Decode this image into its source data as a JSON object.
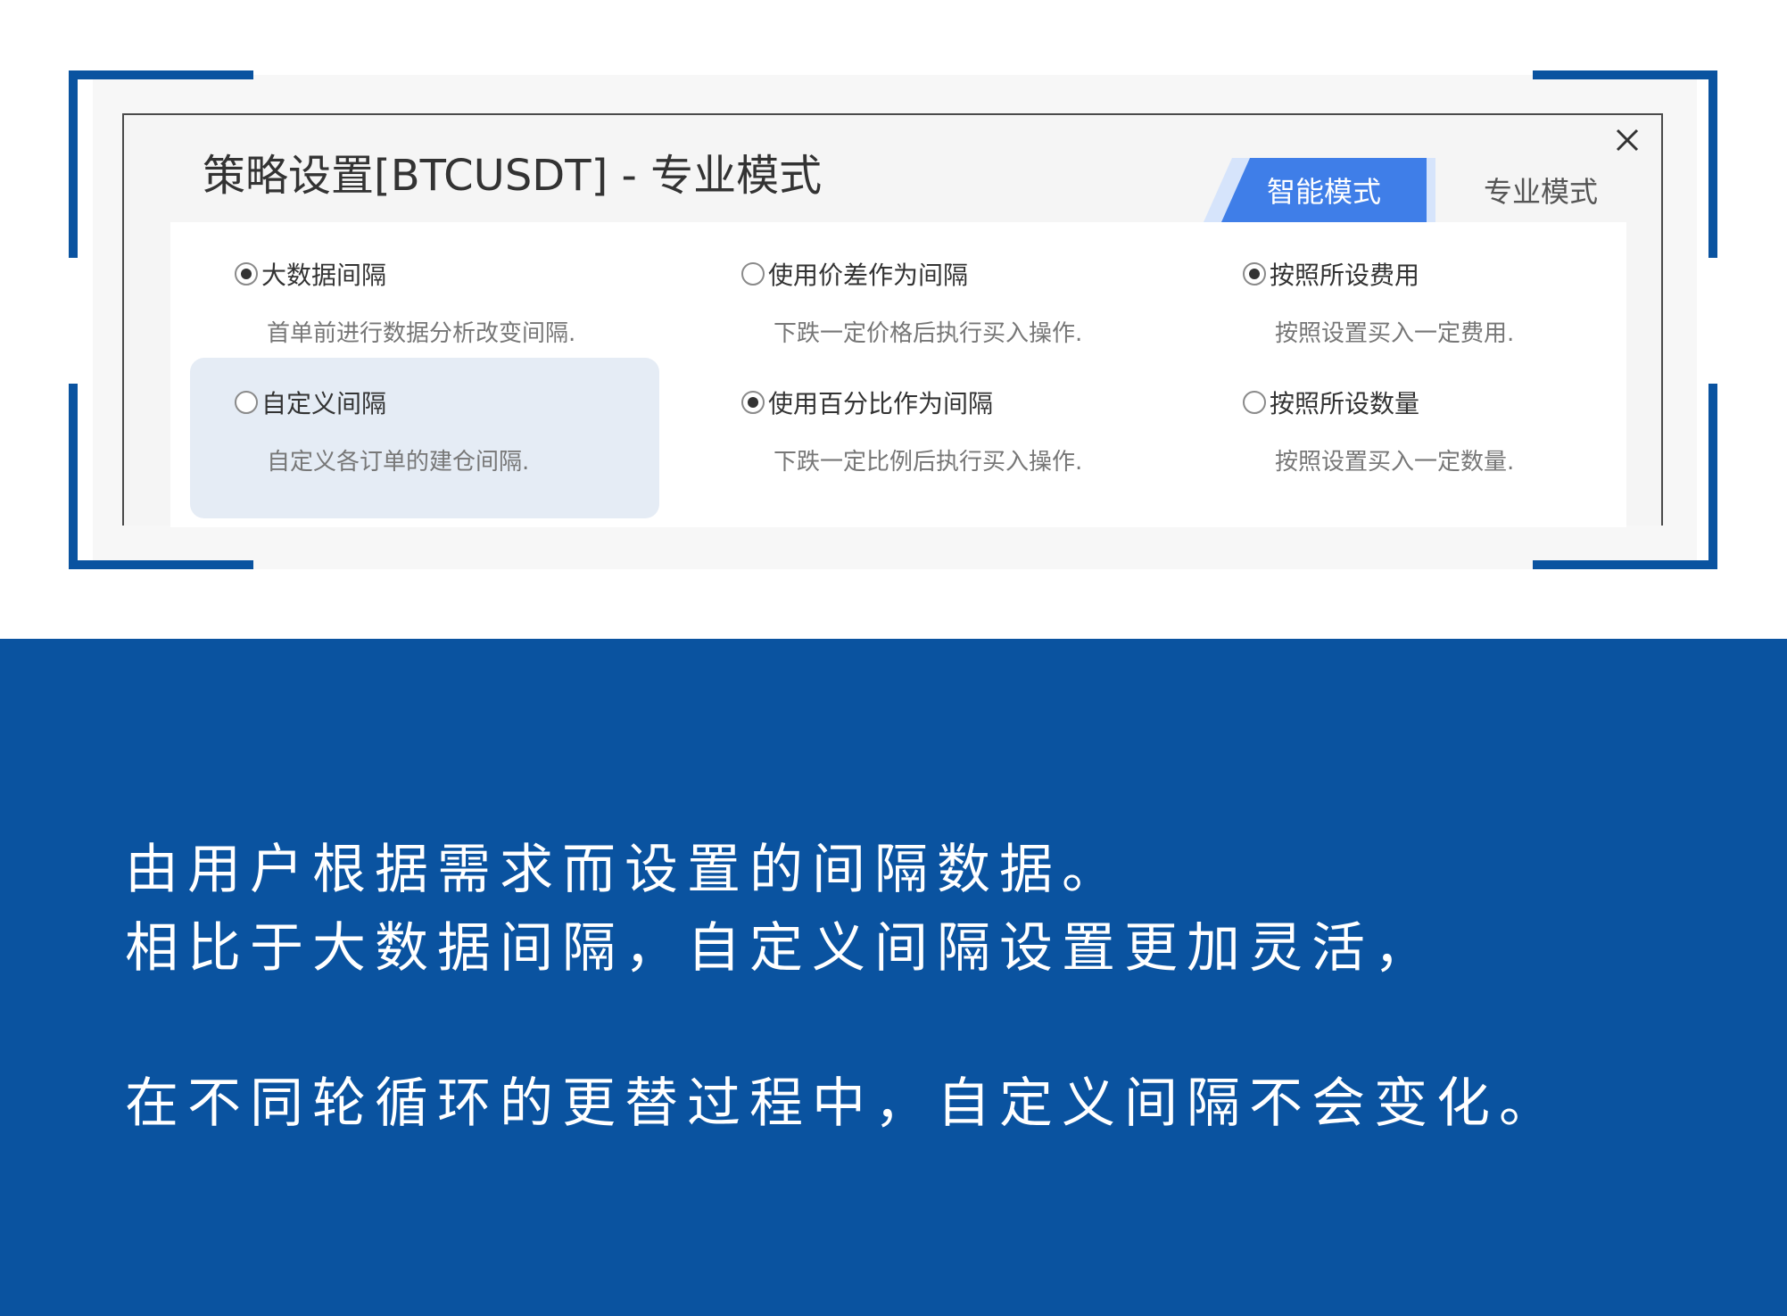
{
  "dialog": {
    "title": "策略设置[BTCUSDT] - 专业模式",
    "tabs": [
      {
        "label": "智能模式",
        "active": true
      },
      {
        "label": "专业模式",
        "active": false
      }
    ],
    "options": [
      {
        "label": "大数据间隔",
        "desc": "首单前进行数据分析改变间隔.",
        "checked": true
      },
      {
        "label": "自定义间隔",
        "desc": "自定义各订单的建仓间隔.",
        "checked": false,
        "highlighted": true
      },
      {
        "label": "使用价差作为间隔",
        "desc": "下跌一定价格后执行买入操作.",
        "checked": false
      },
      {
        "label": "使用百分比作为间隔",
        "desc": "下跌一定比例后执行买入操作.",
        "checked": true
      },
      {
        "label": "按照所设费用",
        "desc": "按照设置买入一定费用.",
        "checked": true
      },
      {
        "label": "按照所设数量",
        "desc": "按照设置买入一定数量.",
        "checked": false
      }
    ]
  },
  "description": {
    "line1": "由用户根据需求而设置的间隔数据。",
    "line2": "相比于大数据间隔，自定义间隔设置更加灵活，",
    "line3": "在不同轮循环的更替过程中，自定义间隔不会变化。"
  },
  "colors": {
    "brand_blue": "#0a53a0",
    "tab_active": "#3f7ee8",
    "highlight": "#e5ecf5"
  }
}
